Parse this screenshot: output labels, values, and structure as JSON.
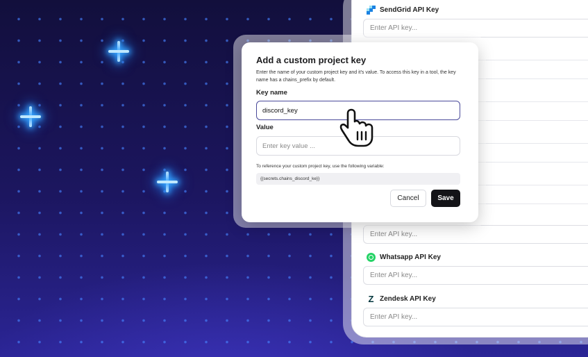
{
  "api_keys": {
    "sendgrid": {
      "label": "SendGrid API Key",
      "placeholder": "Enter API key..."
    },
    "partial": {
      "placeholder": "Enter API key..."
    },
    "whatsapp": {
      "label": "Whatsapp API Key",
      "placeholder": "Enter API key..."
    },
    "zendesk": {
      "label": "Zendesk API Key",
      "placeholder": "Enter API key..."
    }
  },
  "modal": {
    "title": "Add a custom project key",
    "description": "Enter the name of your custom project key and it's value. To access this key in a tool, the key name has a chains_prefix by default.",
    "key_name_label": "Key name",
    "key_name_value": "discord_key",
    "value_label": "Value",
    "value_placeholder": "Enter key value ...",
    "reference_text": "To reference your custom project key, use the following variable:",
    "reference_variable": "{{secrets.chains_discord_ke}}",
    "cancel_label": "Cancel",
    "save_label": "Save"
  },
  "icons": {
    "sendgrid": "sendgrid-icon",
    "whatsapp": "whatsapp-icon",
    "zendesk": "zendesk-icon",
    "cursor": "hand-pointer-icon"
  },
  "colors": {
    "background": "#1a1459",
    "dot": "#4682ff",
    "save_button": "#141418",
    "active_border": "#4a4a9a",
    "whatsapp": "#25d366",
    "sendgrid": "#1a82e2"
  }
}
